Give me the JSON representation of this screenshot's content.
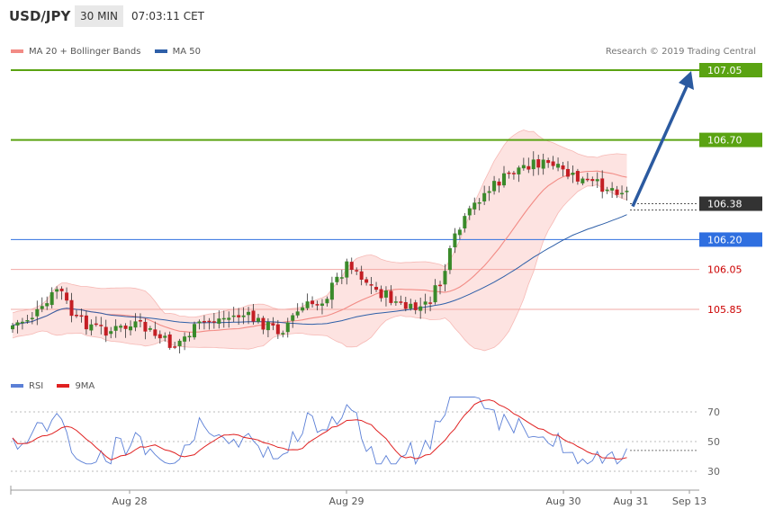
{
  "header": {
    "symbol": "USD/JPY",
    "timeframe": "30 MIN",
    "time": "07:03:11 CET"
  },
  "legend_price": {
    "ma20": {
      "label": "MA 20 + Bollinger Bands",
      "color": "#f28b85"
    },
    "ma50": {
      "label": "MA 50",
      "color": "#2e5fa8"
    }
  },
  "source": "Research © 2019 Trading Central",
  "legend_rsi": {
    "rsi": {
      "label": "RSI",
      "color": "#5b7fd6"
    },
    "ma9": {
      "label": "9MA",
      "color": "#e02020"
    }
  },
  "chart_data": {
    "type": "candlestick",
    "price_levels": [
      {
        "label": "107.05",
        "value": 107.05,
        "style": "target",
        "color": "#5aa312"
      },
      {
        "label": "106.70",
        "value": 106.7,
        "style": "target",
        "color": "#5aa312"
      },
      {
        "label": "106.38",
        "value": 106.38,
        "style": "last",
        "color": "#333333"
      },
      {
        "label": "106.20",
        "value": 106.2,
        "style": "pivot",
        "color": "#2f6fe0"
      },
      {
        "label": "106.05",
        "value": 106.05,
        "style": "support",
        "color": "#cc0000"
      },
      {
        "label": "105.85",
        "value": 105.85,
        "style": "support",
        "color": "#cc0000"
      }
    ],
    "x_labels": [
      "Aug 28",
      "Aug 29",
      "Aug 30",
      "Aug 31",
      "Sep 13"
    ],
    "rsi_ticks": [
      70,
      50,
      30
    ],
    "rsi_ylim": [
      20,
      85
    ],
    "arrow": {
      "from": 106.38,
      "to": 107.05,
      "color": "#2b5aa0"
    }
  }
}
